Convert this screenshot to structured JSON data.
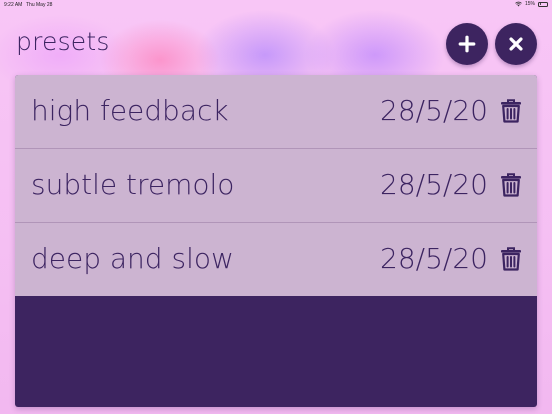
{
  "status_bar": {
    "time": "9:22 AM",
    "date": "Thu May 28",
    "battery": "15%",
    "battery_level": 0.15
  },
  "header": {
    "title": "presets",
    "add_icon": "plus-icon",
    "close_icon": "close-icon"
  },
  "presets": [
    {
      "name": "high feedback",
      "date": "28/5/20",
      "icon": "trash-icon"
    },
    {
      "name": "subtle tremolo",
      "date": "28/5/20",
      "icon": "trash-icon"
    },
    {
      "name": "deep and slow",
      "date": "28/5/20",
      "icon": "trash-icon"
    }
  ],
  "colors": {
    "background": "#f7c3f4",
    "accent": "#3d2460",
    "row_background": "#ccb4d1",
    "text": "#3c2461"
  }
}
